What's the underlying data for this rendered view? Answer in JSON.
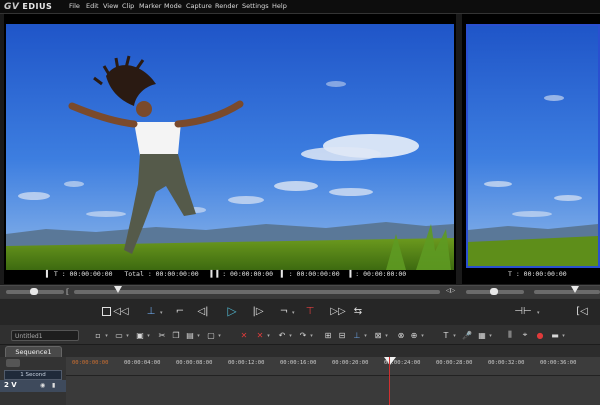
{
  "app": {
    "name": "EDIUS",
    "menu": [
      "File",
      "Edit",
      "View",
      "Clip",
      "Marker",
      "Mode",
      "Capture",
      "Render",
      "Settings",
      "Help"
    ]
  },
  "player": {
    "in_label": "T",
    "in_tc": ": 00:00:00:00",
    "total_label": "Total",
    "total_tc": ": 00:00:00:00",
    "cue_in_tc": ": 00:00:00:00",
    "cue_out_tc": ": 00:00:00:00",
    "out_tc": ": 00:00:00:00"
  },
  "recorder": {
    "in_tc": "T : 00:00:00:00"
  },
  "timeline": {
    "sequence_field": "Untitled1",
    "tab": "Sequence1",
    "scale": "1 Second",
    "track": "2 V",
    "ruler_labels": [
      "00:00:00:00",
      "00:00:04:00",
      "00:00:08:00",
      "00:00:12:00",
      "00:00:16:00",
      "00:00:20:00",
      "00:00:24:00",
      "00:00:28:00",
      "00:00:32:00",
      "00:00:36:00"
    ]
  },
  "colors": {
    "accent": "#2a4fd0",
    "playhead": "#d03030",
    "play_icon": "#4fb0c8"
  }
}
